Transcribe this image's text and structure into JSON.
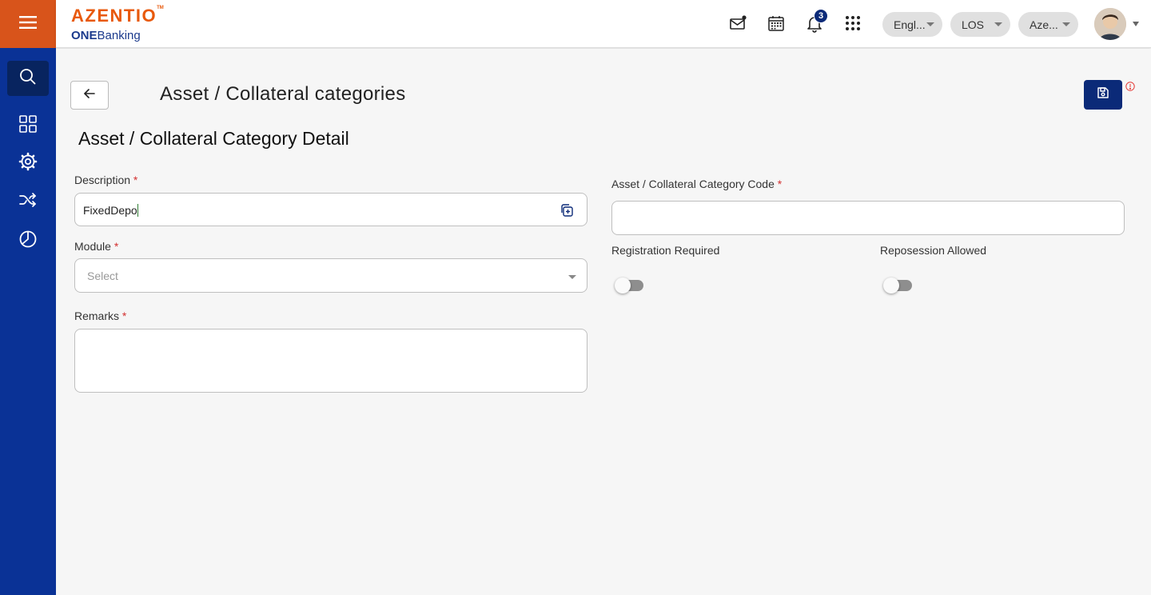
{
  "header": {
    "logo_main": "AZENTIO",
    "logo_tm": "TM",
    "logo_sub_bold": "ONE",
    "logo_sub": "Banking",
    "notification_count": "3",
    "language": "Engl...",
    "module": "LOS",
    "entity": "Aze..."
  },
  "icons": {
    "menu": "hamburger-icon",
    "sidebar": [
      "search-icon",
      "dashboard-grid-icon",
      "settings-gear-icon",
      "shuffle-icon",
      "pie-chart-icon"
    ],
    "header": [
      "mail-icon",
      "calendar-icon",
      "bell-icon",
      "apps-grid-icon"
    ],
    "back": "arrow-left-icon",
    "save": "save-icon",
    "info": "info-icon",
    "copy": "copy-add-icon"
  },
  "page": {
    "title": "Asset / Collateral categories",
    "section_title": "Asset / Collateral Category Detail"
  },
  "form": {
    "description": {
      "label": "Description",
      "required": "*",
      "value": "FixedDepo"
    },
    "module": {
      "label": "Module",
      "required": "*",
      "placeholder": "Select"
    },
    "remarks": {
      "label": "Remarks",
      "required": "*",
      "value": ""
    },
    "category_code": {
      "label": "Asset / Collateral Category Code",
      "required": "*",
      "value": ""
    },
    "registration_required": {
      "label": "Registration Required",
      "checked": false
    },
    "reposession_allowed": {
      "label": "Reposession Allowed",
      "checked": false
    }
  },
  "colors": {
    "sidebar": "#0a3296",
    "menu_button": "#d8541b",
    "brand_orange": "#e8590c",
    "primary": "#0b2a78",
    "required": "#d32f2f"
  }
}
